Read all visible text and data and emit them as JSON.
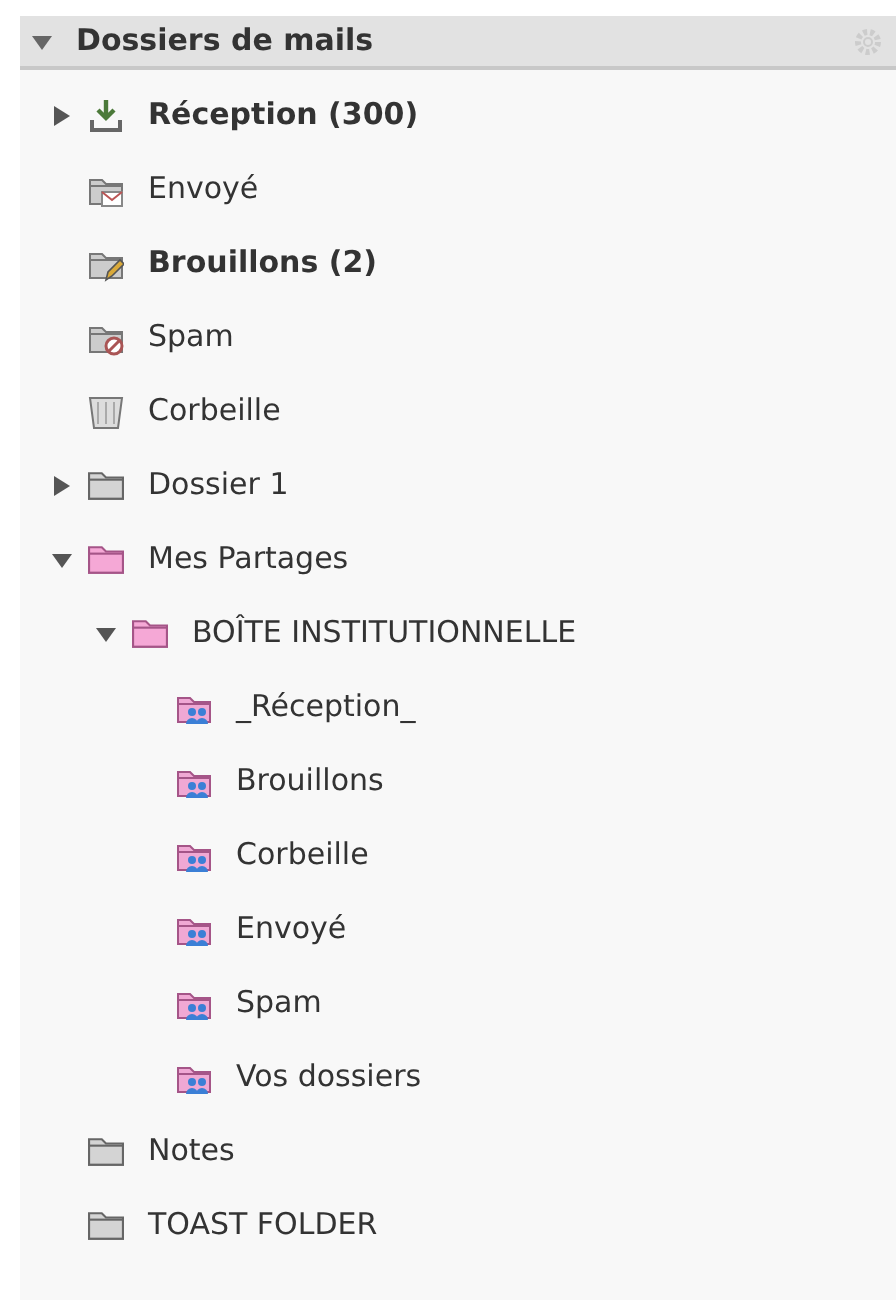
{
  "header": {
    "title": "Dossiers de mails",
    "expanded": true
  },
  "folders": [
    {
      "label": "Réception (300)",
      "kind": "inbox",
      "bold": true,
      "expanded": false
    },
    {
      "label": "Envoyé",
      "kind": "sent",
      "bold": false
    },
    {
      "label": "Brouillons (2)",
      "kind": "drafts",
      "bold": true
    },
    {
      "label": "Spam",
      "kind": "spam",
      "bold": false
    },
    {
      "label": "Corbeille",
      "kind": "trash",
      "bold": false
    },
    {
      "label": "Dossier 1",
      "kind": "folder",
      "bold": false,
      "expanded": false
    },
    {
      "label": "Mes Partages",
      "kind": "shared",
      "bold": false,
      "expanded": true,
      "children": [
        {
          "label": "BOÎTE INSTITUTIONNELLE",
          "kind": "shared",
          "bold": false,
          "expanded": true,
          "children": [
            {
              "label": "_Réception_",
              "kind": "shared_user",
              "bold": false
            },
            {
              "label": "Brouillons",
              "kind": "shared_user",
              "bold": false
            },
            {
              "label": "Corbeille",
              "kind": "shared_user",
              "bold": false
            },
            {
              "label": "Envoyé",
              "kind": "shared_user",
              "bold": false
            },
            {
              "label": "Spam",
              "kind": "shared_user",
              "bold": false
            },
            {
              "label": "Vos dossiers",
              "kind": "shared_user",
              "bold": false
            }
          ]
        }
      ]
    },
    {
      "label": "Notes",
      "kind": "folder",
      "bold": false
    },
    {
      "label": "TOAST FOLDER",
      "kind": "folder",
      "bold": false
    }
  ]
}
